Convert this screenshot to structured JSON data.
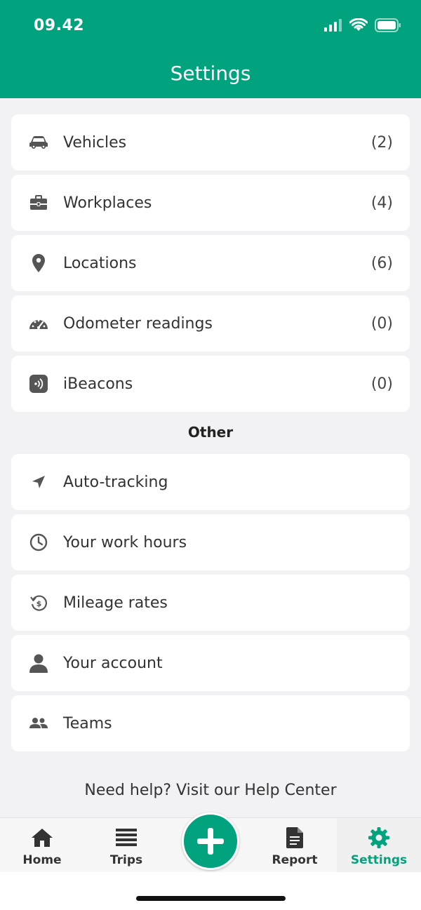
{
  "status_bar": {
    "time": "09.42"
  },
  "header": {
    "title": "Settings"
  },
  "settings_items": [
    {
      "label": "Vehicles",
      "count": "(2)",
      "icon": "car-icon"
    },
    {
      "label": "Workplaces",
      "count": "(4)",
      "icon": "briefcase-icon"
    },
    {
      "label": "Locations",
      "count": "(6)",
      "icon": "location-pin-icon"
    },
    {
      "label": "Odometer readings",
      "count": "(0)",
      "icon": "speedometer-icon"
    },
    {
      "label": "iBeacons",
      "count": "(0)",
      "icon": "beacon-icon"
    }
  ],
  "other_section": {
    "title": "Other",
    "items": [
      {
        "label": "Auto-tracking",
        "icon": "navigation-arrow-icon"
      },
      {
        "label": "Your work hours",
        "icon": "clock-icon"
      },
      {
        "label": "Mileage rates",
        "icon": "dollar-refresh-icon"
      },
      {
        "label": "Your account",
        "icon": "person-icon"
      },
      {
        "label": "Teams",
        "icon": "group-icon"
      }
    ]
  },
  "help_text": "Need help? Visit our Help Center",
  "tabbar": {
    "tabs": [
      {
        "label": "Home",
        "icon": "home-icon"
      },
      {
        "label": "Trips",
        "icon": "list-icon"
      },
      {
        "label": "Report",
        "icon": "document-icon"
      },
      {
        "label": "Settings",
        "icon": "gear-icon",
        "active": true
      }
    ],
    "fab_icon": "plus-icon"
  },
  "colors": {
    "accent": "#00a37e",
    "background": "#f2f2f4",
    "icon_gray": "#555555"
  }
}
